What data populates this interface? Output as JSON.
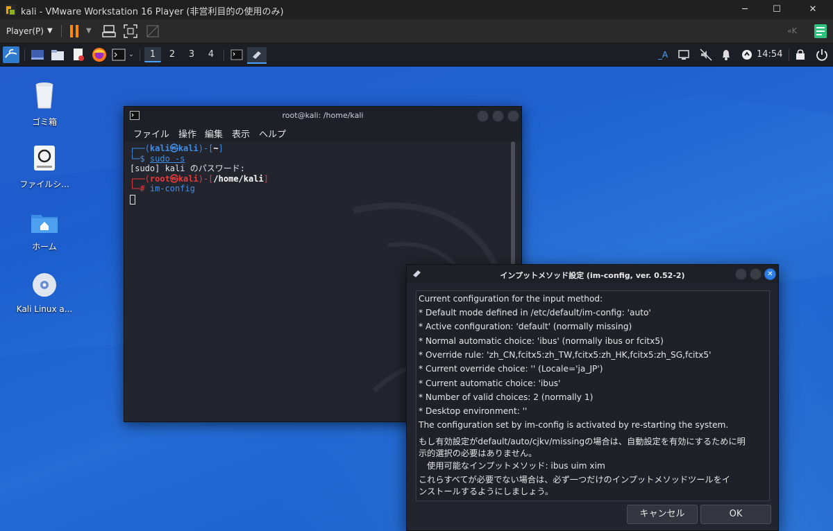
{
  "vmware": {
    "title": "kali - VMware Workstation 16 Player (非営利目的の使用のみ)",
    "player_menu": "Player(P)",
    "colors": {
      "accent": "#ff8a00",
      "library": "#2ec27e"
    }
  },
  "panel": {
    "workspaces": [
      "1",
      "2",
      "3",
      "4"
    ],
    "active_workspace": "1",
    "keyboard_indicator": "_A",
    "clock": "14:54"
  },
  "desktop": {
    "icons": [
      {
        "label": "ゴミ箱",
        "icon": "trash-icon"
      },
      {
        "label": "ファイルシ...",
        "icon": "filesystem-icon"
      },
      {
        "label": "ホーム",
        "icon": "home-folder-icon"
      },
      {
        "label": "Kali Linux a...",
        "icon": "disc-icon"
      }
    ]
  },
  "terminal": {
    "title": "root@kali: /home/kali",
    "menu": [
      "ファイル",
      "操作",
      "編集",
      "表示",
      "ヘルプ"
    ],
    "prompt1": {
      "user": "kali",
      "host": "kali",
      "dir": "~",
      "command": "sudo -s"
    },
    "password_line": "[sudo] kali のパスワード:",
    "prompt2": {
      "user": "root",
      "host": "kali",
      "dir": "/home/kali",
      "command": "im-config"
    }
  },
  "dialog": {
    "title": "インプットメソッド設定 (im-config, ver. 0.52-2)",
    "lines": [
      "Current configuration for the input method:",
      " * Default mode defined in /etc/default/im-config: 'auto'",
      " * Active configuration: 'default' (normally missing)",
      " * Normal automatic choice: 'ibus' (normally ibus or fcitx5)",
      " * Override rule: 'zh_CN,fcitx5:zh_TW,fcitx5:zh_HK,fcitx5:zh_SG,fcitx5'",
      " * Current override choice: '' (Locale='ja_JP')",
      " * Current automatic choice: 'ibus'",
      " * Number of valid choices: 2 (normally 1)",
      " * Desktop environment: ''",
      "The configuration set by im-config is activated by re-starting the system.",
      "もし有効設定がdefault/auto/cjkv/missingの場合は、自動設定を有効にするために明",
      "示的選択の必要はありません。",
      "　使用可能なインプットメソッド: ibus uim xim",
      "これらすべてが必要でない場合は、必ず一つだけのインプットメソッドツールをイ",
      "ンストールするようにしましょう。"
    ],
    "cancel_label": "キャンセル",
    "ok_label": "OK"
  }
}
